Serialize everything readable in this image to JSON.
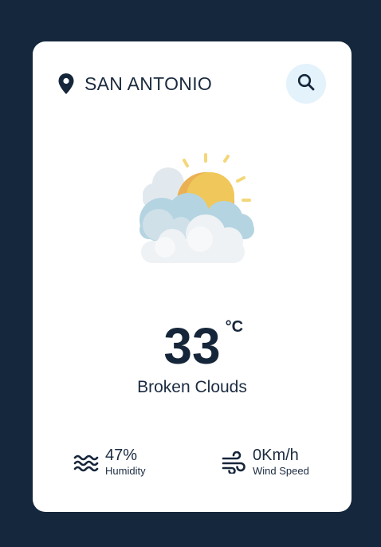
{
  "location": {
    "icon": "map-pin-icon",
    "city": "SAN ANTONIO"
  },
  "search": {
    "icon": "search-icon"
  },
  "weather": {
    "icon": "partly-cloudy-sun-icon",
    "temperature": "33",
    "unit": "°C",
    "description": "Broken Clouds"
  },
  "stats": {
    "humidity": {
      "icon": "waves-icon",
      "value": "47%",
      "label": "Humidity"
    },
    "wind": {
      "icon": "wind-icon",
      "value": "0Km/h",
      "label": "Wind Speed"
    }
  },
  "colors": {
    "background": "#15273d",
    "card": "#ffffff",
    "text": "#1b2b40",
    "search_bg": "#e3f2fb",
    "sun": "#f0c14b"
  }
}
